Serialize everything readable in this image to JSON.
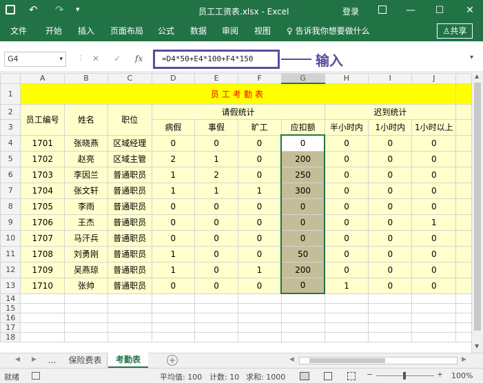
{
  "title": {
    "file": "员工工资表.xlsx",
    "sep": "-",
    "app": "Excel",
    "login": "登录"
  },
  "qat": {
    "save_icon": "save-icon",
    "undo": "↶",
    "redo": "↷",
    "more": "▾"
  },
  "ribbon": {
    "tabs": [
      "文件",
      "开始",
      "插入",
      "页面布局",
      "公式",
      "数据",
      "审阅",
      "视图"
    ],
    "tellme": "告诉我你想要做什么",
    "share": "共享"
  },
  "formula": {
    "namebox": "G4",
    "cancel": "✕",
    "enter": "✓",
    "fx": "fx",
    "value": "=D4*50+E4*100+F4*150",
    "annotation": "输入"
  },
  "grid": {
    "columns": [
      "A",
      "B",
      "C",
      "D",
      "E",
      "F",
      "G",
      "H",
      "I",
      "J"
    ],
    "row_numbers": [
      "1",
      "2",
      "3",
      "4",
      "5",
      "6",
      "7",
      "8",
      "9",
      "10",
      "11",
      "12",
      "13",
      "14",
      "15",
      "16",
      "17",
      "18"
    ],
    "title": "员工考勤表",
    "headers": {
      "id": "员工编号",
      "name": "姓名",
      "position": "职位",
      "leave_group": "请假统计",
      "sick": "病假",
      "personal": "事假",
      "absent": "旷工",
      "deduct": "应扣额",
      "late_group": "迟到统计",
      "half": "半小时内",
      "one": "1小时内",
      "over": "1小时以上"
    },
    "rows": [
      [
        "1701",
        "张晓燕",
        "区域经理",
        "0",
        "0",
        "0",
        "0",
        "0",
        "0",
        "0"
      ],
      [
        "1702",
        "赵亮",
        "区域主管",
        "2",
        "1",
        "0",
        "200",
        "0",
        "0",
        "0"
      ],
      [
        "1703",
        "李因兰",
        "普通职员",
        "1",
        "2",
        "0",
        "250",
        "0",
        "0",
        "0"
      ],
      [
        "1704",
        "张文轩",
        "普通职员",
        "1",
        "1",
        "1",
        "300",
        "0",
        "0",
        "0"
      ],
      [
        "1705",
        "李雨",
        "普通职员",
        "0",
        "0",
        "0",
        "0",
        "0",
        "0",
        "0"
      ],
      [
        "1706",
        "王杰",
        "普通职员",
        "0",
        "0",
        "0",
        "0",
        "0",
        "0",
        "1"
      ],
      [
        "1707",
        "马汗兵",
        "普通职员",
        "0",
        "0",
        "0",
        "0",
        "0",
        "0",
        "0"
      ],
      [
        "1708",
        "刘勇刚",
        "普通职员",
        "1",
        "0",
        "0",
        "50",
        "0",
        "0",
        "0"
      ],
      [
        "1709",
        "吴燕琼",
        "普通职员",
        "1",
        "0",
        "1",
        "200",
        "0",
        "0",
        "0"
      ],
      [
        "1710",
        "张帅",
        "普通职员",
        "0",
        "0",
        "0",
        "0",
        "1",
        "0",
        "0"
      ]
    ]
  },
  "sheets": {
    "ellipsis": "...",
    "items": [
      "保险费表",
      "考勤表"
    ],
    "active": "考勤表",
    "add": "+"
  },
  "status": {
    "mode": "就绪",
    "average": "平均值: 100",
    "count": "计数: 10",
    "sum": "求和: 1000",
    "zoom": "100%"
  }
}
